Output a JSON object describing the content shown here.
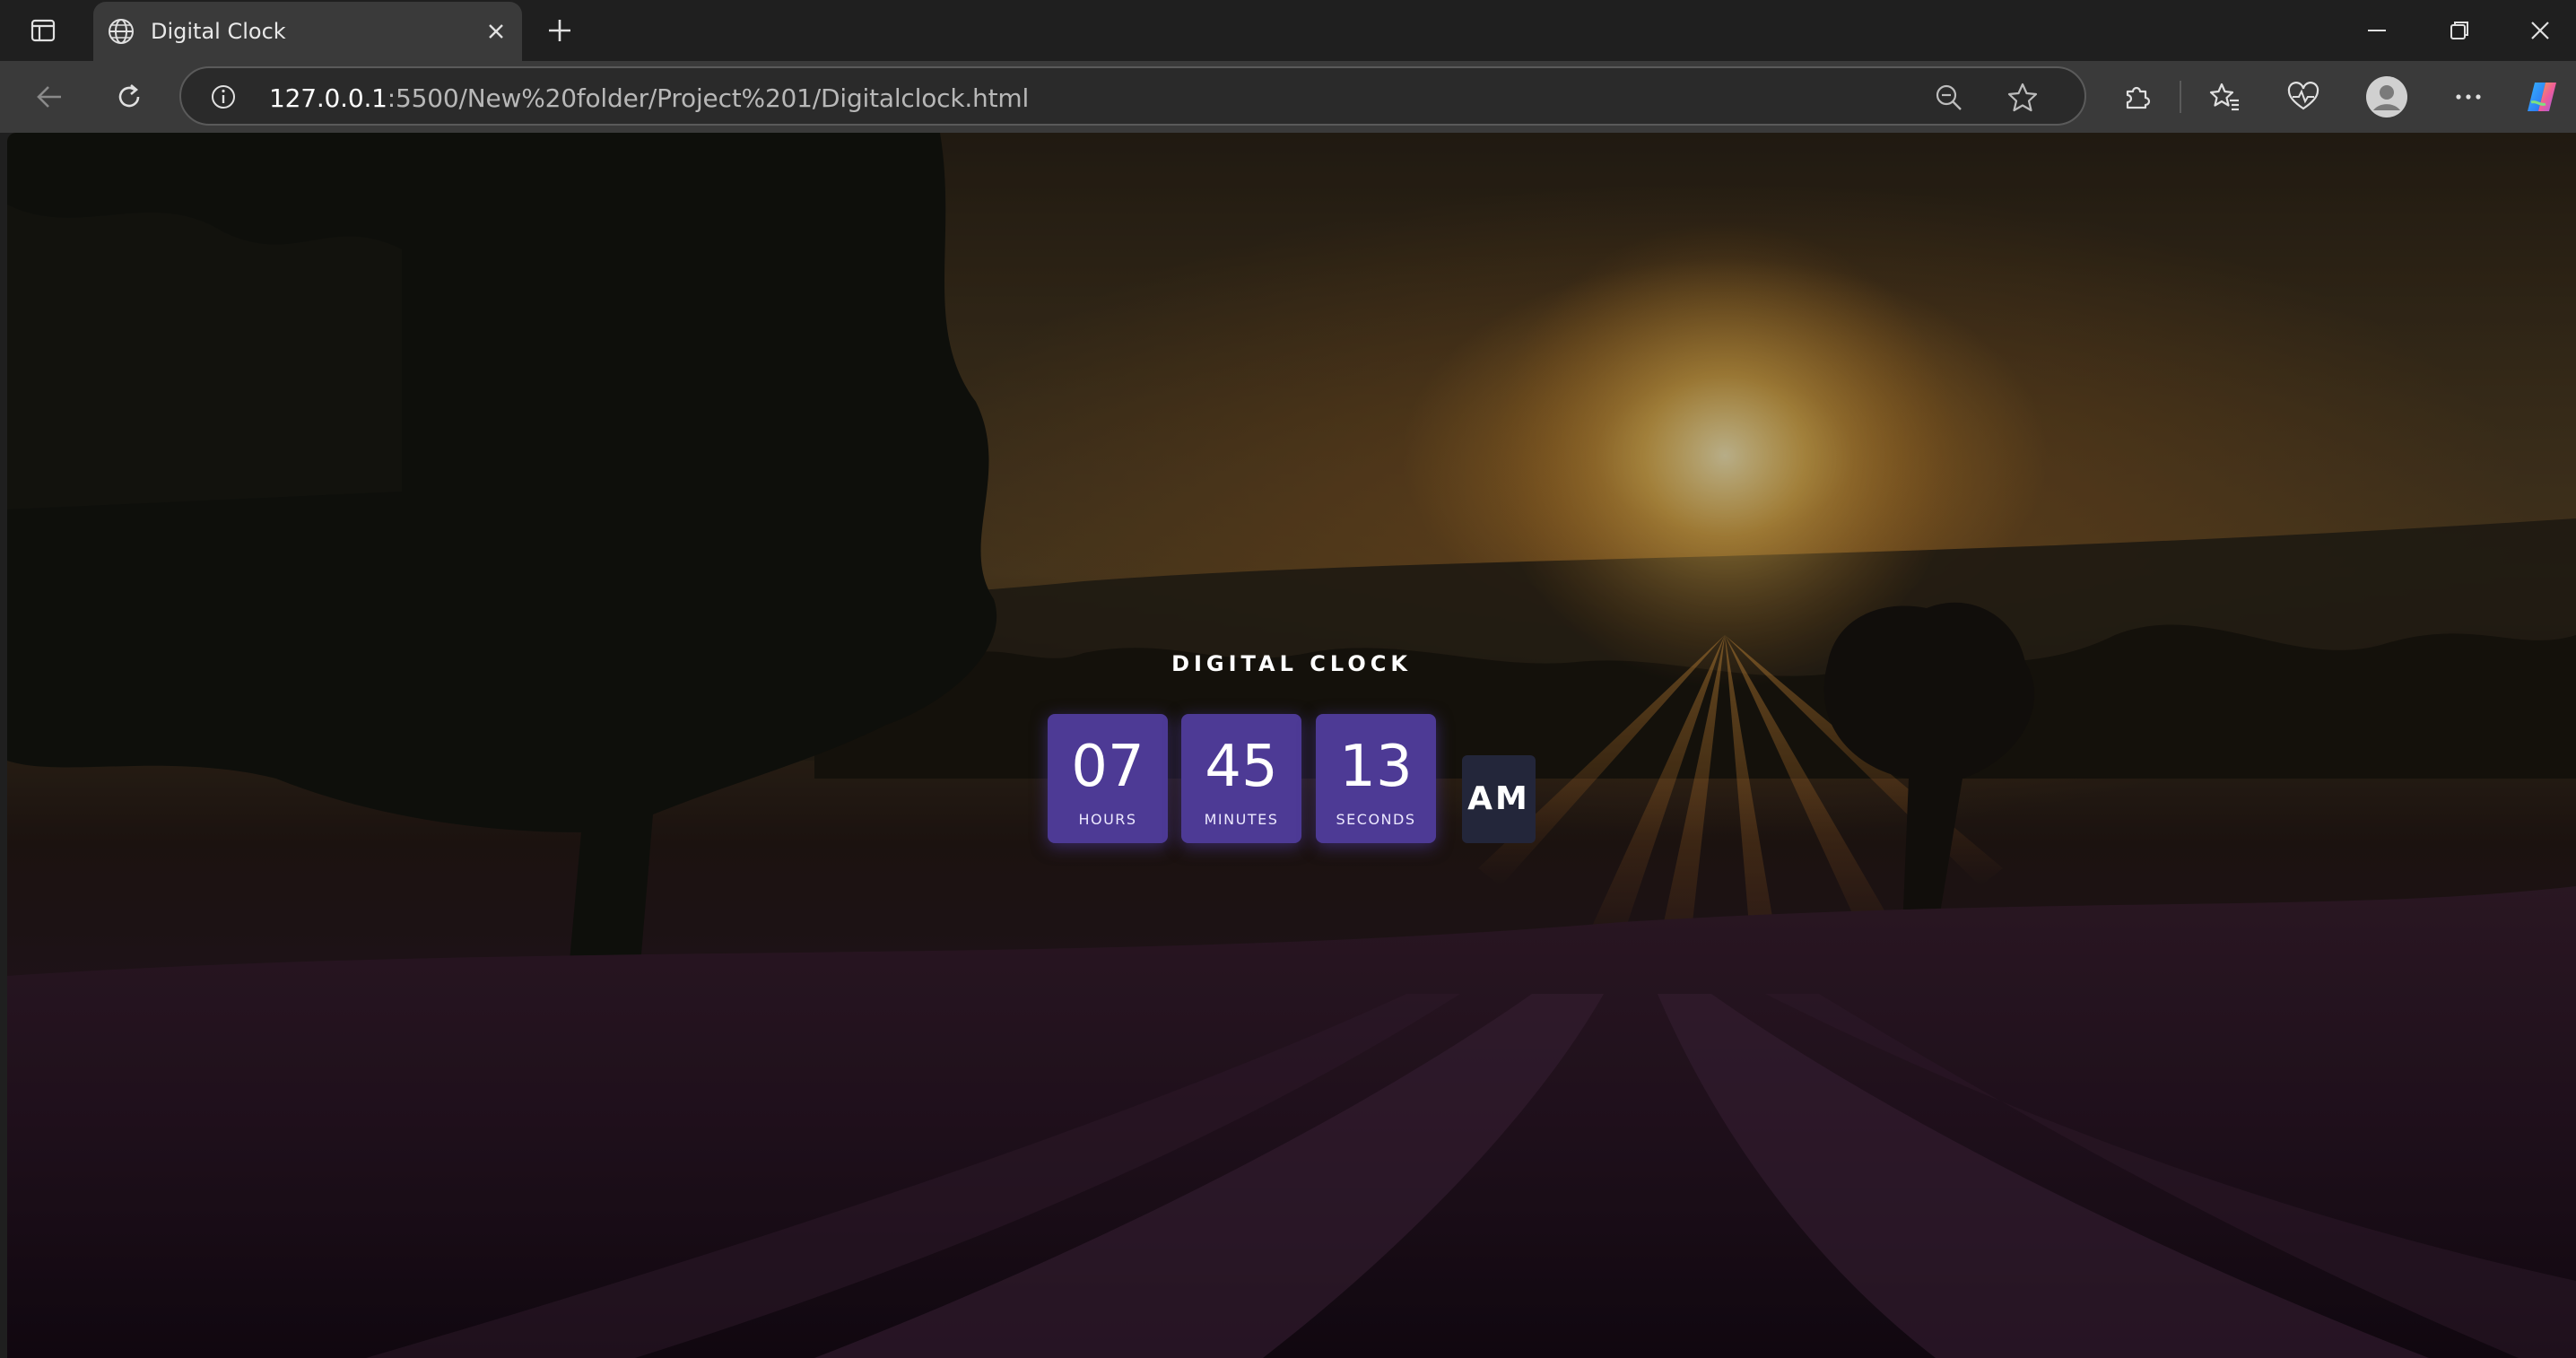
{
  "browser": {
    "tab_title": "Digital Clock",
    "url_host": "127.0.0.1",
    "url_rest": ":5500/New%20folder/Project%201/Digitalclock.html"
  },
  "icons": {
    "tab_actions": "tab-actions-icon",
    "favicon": "globe-icon",
    "close_tab": "close-icon",
    "new_tab": "plus-icon",
    "minimize": "minimize-icon",
    "restore": "restore-icon",
    "close_window": "close-icon",
    "back": "back-arrow-icon",
    "refresh": "refresh-icon",
    "site_info": "info-icon",
    "zoom": "zoom-out-icon",
    "favorite": "star-icon",
    "extensions": "puzzle-icon",
    "favorites": "favorites-icon",
    "health": "heart-pulse-icon",
    "profile": "avatar-icon",
    "menu": "more-icon",
    "copilot": "copilot-icon"
  },
  "clock": {
    "title": "DIGITAL CLOCK",
    "hours": "07",
    "hours_label": "HOURS",
    "minutes": "45",
    "minutes_label": "MINUTES",
    "seconds": "13",
    "seconds_label": "SECONDS",
    "period": "AM"
  },
  "colors": {
    "unit_bg": "#4d3a95",
    "period_bg": "#23263a",
    "tab_active": "#3a3a3a",
    "toolbar": "#3a3a3a"
  }
}
